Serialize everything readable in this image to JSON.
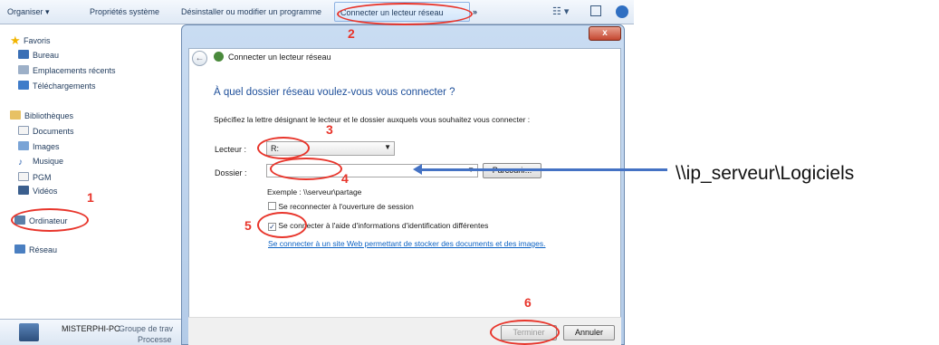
{
  "toolbar": {
    "organize": "Organiser ▾",
    "system_props": "Propriétés système",
    "uninstall": "Désinstaller ou modifier un programme",
    "map_drive": "Connecter un lecteur réseau",
    "more": "»"
  },
  "nav": {
    "favorites": "Favoris",
    "desktop": "Bureau",
    "recent": "Emplacements récents",
    "downloads": "Téléchargements",
    "libraries": "Bibliothèques",
    "documents": "Documents",
    "images": "Images",
    "music": "Musique",
    "pgm": "PGM",
    "videos": "Vidéos",
    "computer": "Ordinateur",
    "network": "Réseau"
  },
  "details": {
    "pc_name": "MISTERPHI-PC",
    "workgroup": "Groupe de trav",
    "processor": "Processe"
  },
  "dialog": {
    "close": "x",
    "nav_title": "Connecter un lecteur réseau",
    "heading": "À quel dossier réseau voulez-vous vous connecter ?",
    "instruction": "Spécifiez la lettre désignant le lecteur et le dossier auxquels vous souhaitez vous connecter :",
    "drive_label": "Lecteur :",
    "drive_value": "R:",
    "folder_label": "Dossier :",
    "folder_value": "",
    "browse": "Parcourir...",
    "example": "Exemple : \\\\serveur\\partage",
    "reconnect": "Se reconnecter à l'ouverture de session",
    "other_creds": "Se connecter à l'aide d'informations d'identification différentes",
    "web_link": "Se connecter à un site Web permettant de stocker des documents et des images.",
    "finish": "Terminer",
    "cancel": "Annuler"
  },
  "annotations": {
    "n1": "1",
    "n2": "2",
    "n3": "3",
    "n4": "4",
    "n5": "5",
    "n6": "6",
    "path": "\\\\ip_serveur\\Logiciels",
    "color": "#e8352b",
    "arrow_color": "#4472c4"
  },
  "state": {
    "reconnect_checked": false,
    "other_creds_checked": true
  }
}
